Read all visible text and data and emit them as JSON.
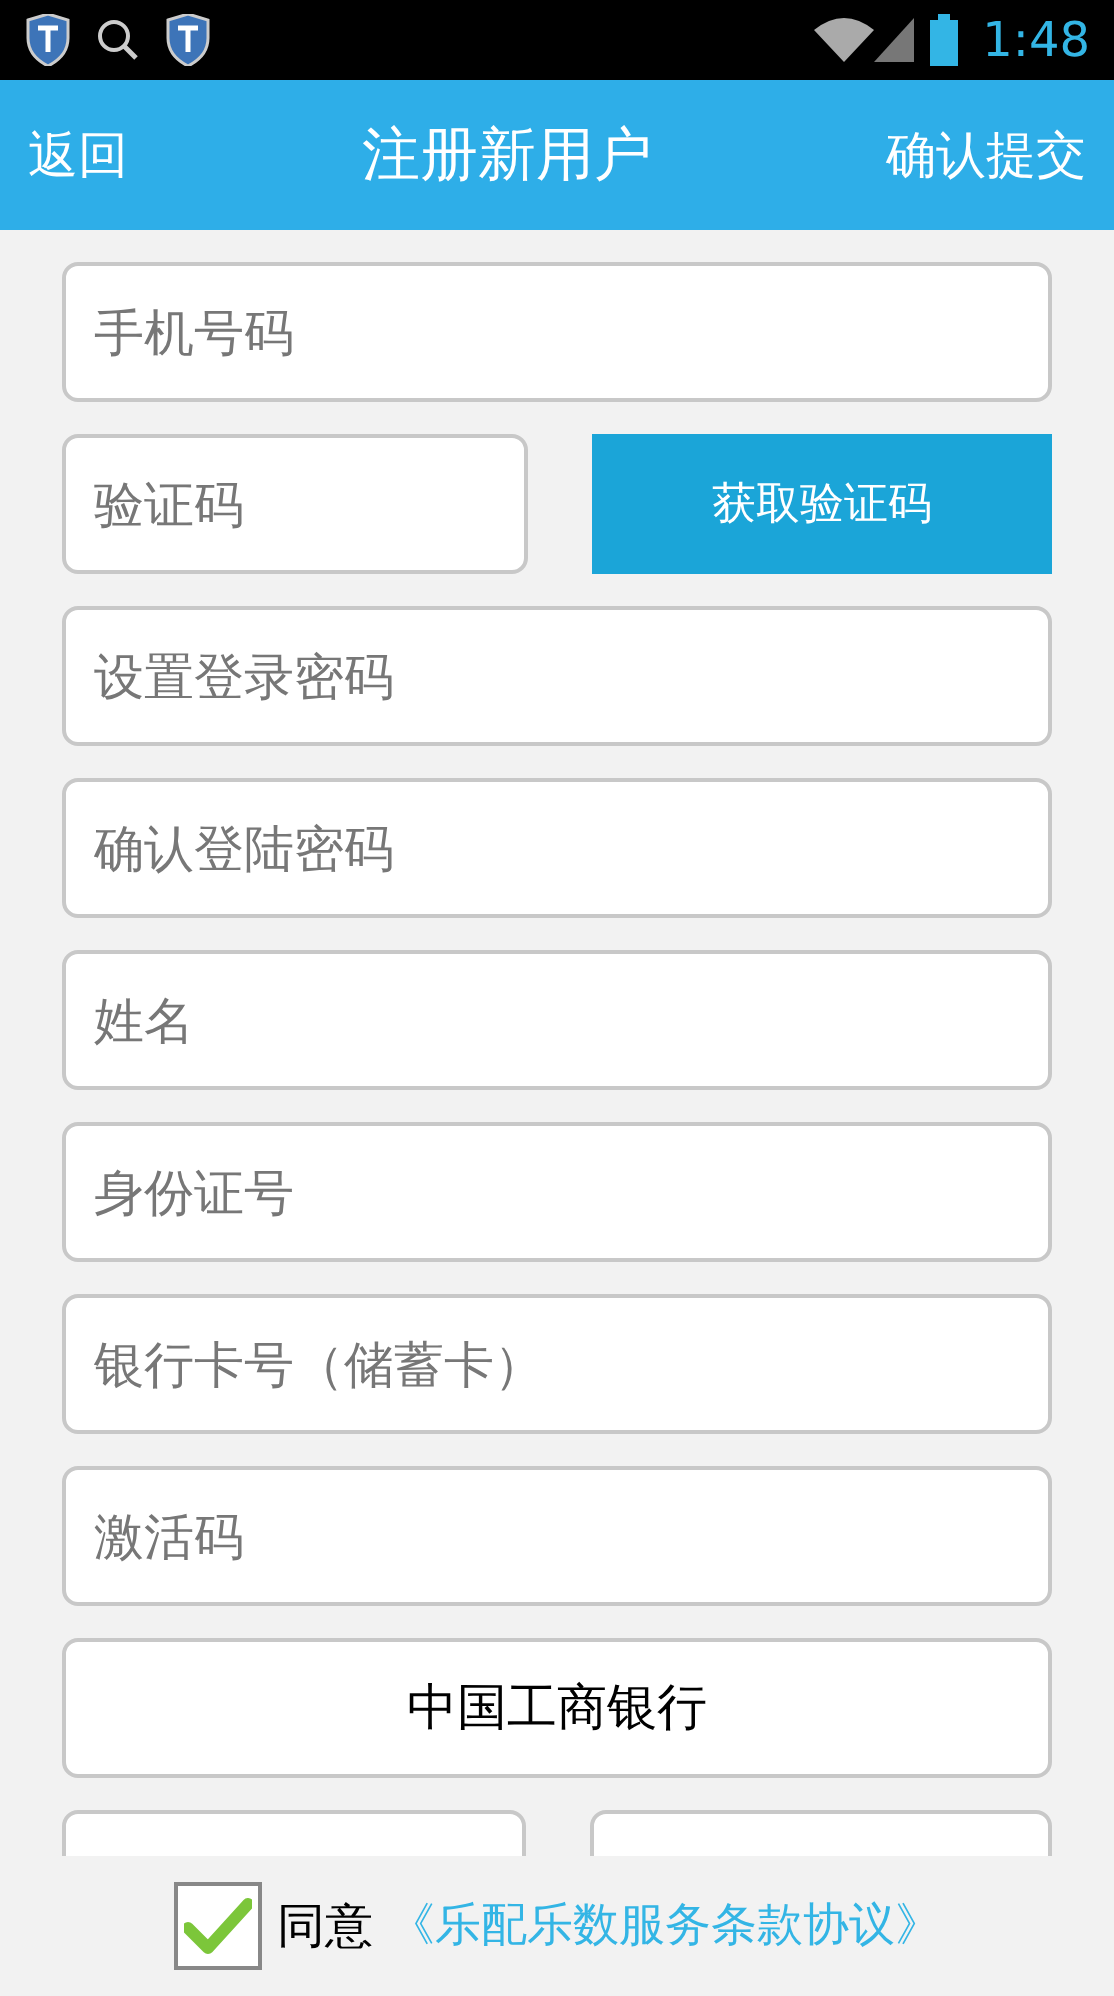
{
  "status_bar": {
    "time": "1:48"
  },
  "header": {
    "back": "返回",
    "title": "注册新用户",
    "submit": "确认提交"
  },
  "form": [
    {
      "kind": "field",
      "placeholder": "手机号码"
    },
    {
      "kind": "code",
      "placeholder": "验证码",
      "button": "获取验证码"
    },
    {
      "kind": "field",
      "placeholder": "设置登录密码"
    },
    {
      "kind": "field",
      "placeholder": "确认登陆密码"
    },
    {
      "kind": "field",
      "placeholder": "姓名"
    },
    {
      "kind": "field",
      "placeholder": "身份证号"
    },
    {
      "kind": "field",
      "placeholder": "银行卡号（储蓄卡）"
    },
    {
      "kind": "field",
      "placeholder": "激活码"
    },
    {
      "kind": "select",
      "value": "中国工商银行"
    },
    {
      "kind": "pair"
    }
  ],
  "agreement": {
    "checked": true,
    "label": "同意",
    "link": "《乐配乐数服务条款协议》"
  }
}
